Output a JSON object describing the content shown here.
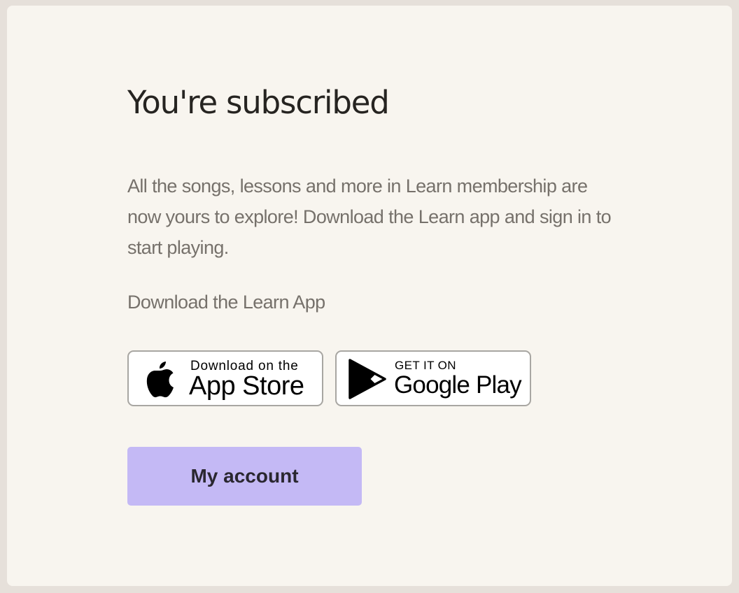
{
  "page": {
    "title": "You're subscribed",
    "description": "All the songs, lessons and more in Learn membership are now yours to explore! Download the Learn app and sign in to start playing.",
    "download_heading": "Download the Learn App"
  },
  "app_store": {
    "small_text": "Download on the",
    "big_text": "App Store",
    "icon": "apple-icon"
  },
  "google_play": {
    "small_text": "GET IT ON",
    "big_text": "Google Play",
    "icon": "google-play-icon"
  },
  "account_button": {
    "label": "My account",
    "color": "#c4b9f5"
  },
  "colors": {
    "background": "#e6e0da",
    "card": "#f8f5ef",
    "heading": "#262421",
    "body_text": "#76716b"
  }
}
